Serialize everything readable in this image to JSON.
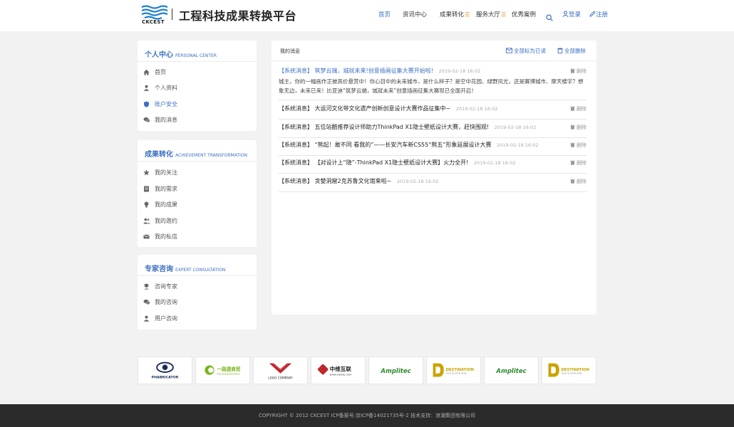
{
  "header": {
    "logo_text": "CKCEST",
    "title": "工程科技成果转换平台",
    "nav": [
      {
        "label": "首页",
        "active": true
      },
      {
        "label": "资讯中心",
        "active": false
      },
      {
        "label": "成果转化",
        "active": false
      },
      {
        "label": "服务大厅",
        "active": false
      },
      {
        "label": "优秀案例",
        "active": false
      }
    ],
    "login": "登录",
    "register": "注册"
  },
  "sidebar": {
    "sections": [
      {
        "title": "个人中心",
        "subtitle": "PERSONAL CENTER",
        "items": [
          {
            "label": "首页",
            "icon": "home-icon"
          },
          {
            "label": "个人资料",
            "icon": "user-icon"
          },
          {
            "label": "账户安全",
            "icon": "shield-icon",
            "active": true
          },
          {
            "label": "我的消息",
            "icon": "chat-icon"
          }
        ]
      },
      {
        "title": "成果转化",
        "subtitle": "ACHIEVEMENT TRANSFORMATION",
        "items": [
          {
            "label": "我的关注",
            "icon": "star-icon"
          },
          {
            "label": "我的需求",
            "icon": "list-icon"
          },
          {
            "label": "我的成果",
            "icon": "bulb-icon"
          },
          {
            "label": "我的邀约",
            "icon": "users-icon"
          },
          {
            "label": "我的私信",
            "icon": "mail-icon"
          }
        ]
      },
      {
        "title": "专家咨询",
        "subtitle": "EXPERT CONSULTATION",
        "items": [
          {
            "label": "咨询专家",
            "icon": "expert-icon"
          },
          {
            "label": "我的咨询",
            "icon": "chat-icon"
          },
          {
            "label": "用户咨询",
            "icon": "user-icon"
          }
        ]
      }
    ]
  },
  "main": {
    "title": "我的消息",
    "mark_all_read": "全部标为已读",
    "delete_all": "全部删除",
    "delete_label": "删除",
    "messages": [
      {
        "tag": "【系统消息】",
        "title": "筑梦云端，城就未来!创意插画征集大赛开始啦!",
        "date": "2019-02-18 16:02",
        "unread": true,
        "body": "城主，你的一幅画作正被高价悬赏中！你心目中的未来城市，是什么样子？是空中花园、绿野风光，还是赛博城市、摩天楼宇？想象无边，未来已来！比亚迪“筑梦云端，城就未来”创意插画征集大赛现已全面开启！"
      },
      {
        "tag": "【系统消息】",
        "title": "大运河文化带文化遗产创新创意设计大赛作品征集中~",
        "date": "2019-02-18 16:02",
        "unread": false,
        "body": ""
      },
      {
        "tag": "【系统消息】",
        "title": "五位站酷推荐设计师助力ThinkPad X1隐士壁纸设计大赛，赶快围观!",
        "date": "2019-02-18 16:02",
        "unread": false,
        "body": ""
      },
      {
        "tag": "【系统消息】",
        "title": "“熊起！敢不同 看我的”——长安汽车新CS55“熊五”形象延展设计大赛",
        "date": "2019-02-18 16:02",
        "unread": false,
        "body": ""
      },
      {
        "tag": "【系统消息】",
        "title": "【对设计上“隐”-ThinkPad X1隐士壁纸设计大赛】火力全开!",
        "date": "2019-02-18 16:02",
        "unread": false,
        "body": ""
      },
      {
        "tag": "【系统消息】",
        "title": "贪婪洞窟2克苏鲁文化馆来啦~",
        "date": "2019-02-18 16:02",
        "unread": false,
        "body": ""
      }
    ]
  },
  "partners": [
    {
      "name": "PHABRICATOR",
      "sub": "",
      "color": "#1a2a5a"
    },
    {
      "name": "一路捷商贸",
      "sub": "Yunlutong Business",
      "color": "#7ab51d"
    },
    {
      "name": "LOGO COMPANY",
      "sub": "",
      "color": "#c0262d"
    },
    {
      "name": "中维互联",
      "sub": "www.ziwise.com",
      "color": "#c0262d"
    },
    {
      "name": "Amplitec",
      "sub": "",
      "color": "#2e8b2e"
    },
    {
      "name": "DESTINATION",
      "sub": "YOUR SLOGAN HERE",
      "color": "#c8a400"
    },
    {
      "name": "Amplitec",
      "sub": "",
      "color": "#2e8b2e"
    },
    {
      "name": "DESTINATION",
      "sub": "YOUR SLOGAN HERE",
      "color": "#c8a400"
    }
  ],
  "footer": {
    "text": "COPYRIGHT © 2012 CKCEST ICP备案号:京ICP备14021735号-2  技术支持：浪潮集团有限公司"
  },
  "colors": {
    "accent": "#3c6fc2",
    "menu_icon": "#f08a24",
    "footer_bg": "#2b2b2b"
  }
}
